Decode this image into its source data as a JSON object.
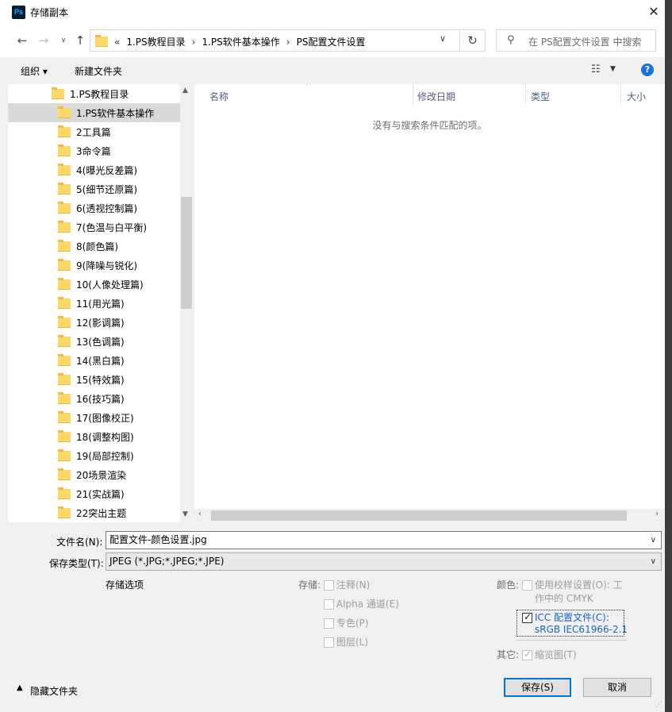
{
  "window": {
    "title": "存储副本",
    "app_icon": "Ps"
  },
  "nav": {
    "breadcrumb_overflow": "«",
    "breadcrumbs": [
      "1.PS教程目录",
      "1.PS软件基本操作",
      "PS配置文件设置"
    ],
    "search_placeholder": "在 PS配置文件设置 中搜索"
  },
  "toolbar": {
    "organize": "组织 ▾",
    "new_folder": "新建文件夹",
    "help": "?"
  },
  "tree": {
    "items": [
      "1.PS教程目录",
      "1.PS软件基本操作",
      "2工具篇",
      "3命令篇",
      "4(曝光反差篇)",
      "5(细节还原篇)",
      "6(透视控制篇)",
      "7(色温与白平衡)",
      "8(颜色篇)",
      "9(降噪与锐化)",
      "10(人像处理篇)",
      "11(用光篇)",
      "12(影调篇)",
      "13(色调篇)",
      "14(黑白篇)",
      "15(特效篇)",
      "16(技巧篇)",
      "17(图像校正)",
      "18(调整构图)",
      "19(局部控制)",
      "20场景渲染",
      "21(实战篇)",
      "22突出主题"
    ],
    "selected_index": 1
  },
  "filelist": {
    "columns": [
      "名称",
      "修改日期",
      "类型",
      "大小"
    ],
    "empty_message": "没有与搜索条件匹配的项。"
  },
  "form": {
    "filename_label": "文件名(N):",
    "filename_value": "配置文件-颜色设置.jpg",
    "filetype_label": "保存类型(T):",
    "filetype_value": "JPEG (*.JPG;*.JPEG;*.JPE)",
    "save_options_label": "存储选项",
    "storage_label": "存储:",
    "opt_notes": "注释(N)",
    "opt_alpha": "Alpha 通道(E)",
    "opt_spot": "专色(P)",
    "opt_layers": "图层(L)",
    "color_label": "颜色:",
    "proof_line1": "使用校样设置(O): 工",
    "proof_line2": "作中的 CMYK",
    "icc_line1": "ICC 配置文件(C):",
    "icc_line2": "sRGB IEC61966-2.1",
    "other_label": "其它:",
    "thumbnail": "缩览图(T)"
  },
  "footer": {
    "hide_folders": "隐藏文件夹",
    "save_button": "保存(S)",
    "cancel_button": "取消"
  },
  "colors": {
    "accent": "#0078d7",
    "link": "#1a64c8",
    "folder": "#ffd767"
  }
}
